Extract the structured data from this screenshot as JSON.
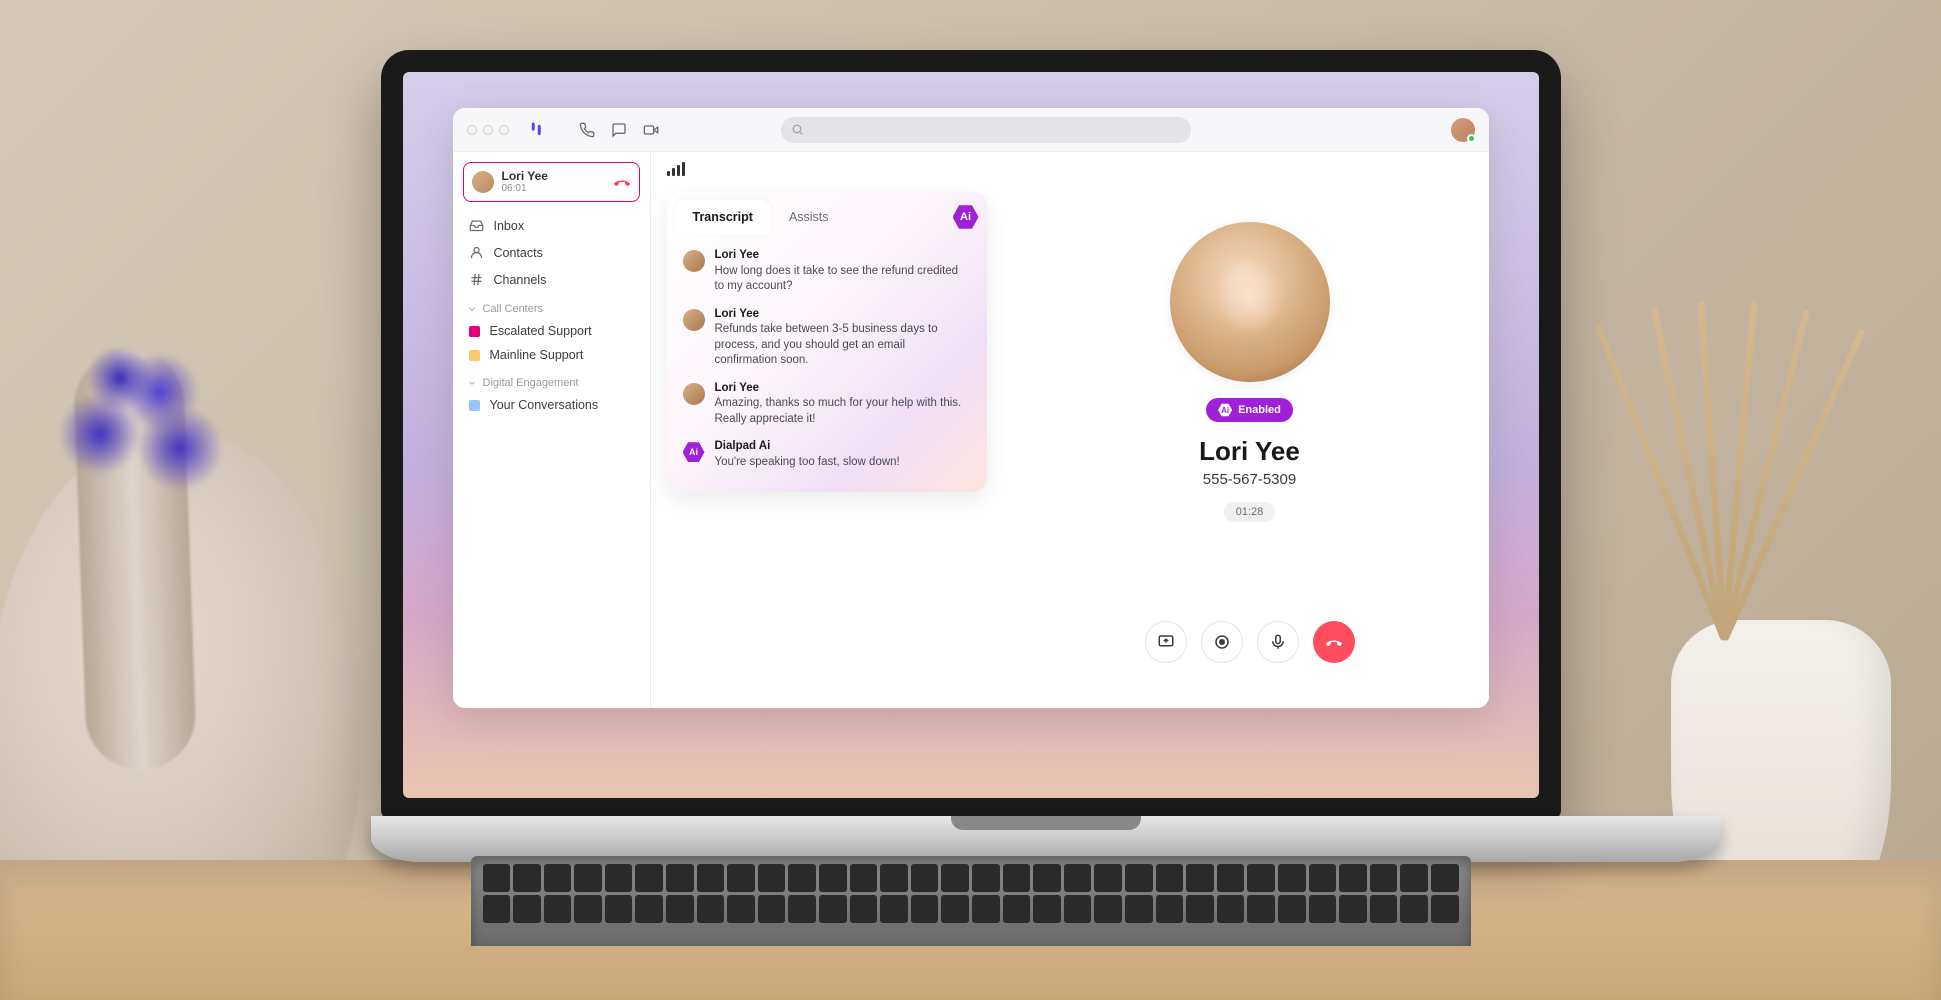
{
  "sidebar": {
    "active_call": {
      "name": "Lori Yee",
      "duration": "06:01"
    },
    "nav": {
      "inbox": "Inbox",
      "contacts": "Contacts",
      "channels": "Channels"
    },
    "sections": {
      "call_centers": {
        "label": "Call Centers",
        "items": [
          "Escalated Support",
          "Mainline Support"
        ]
      },
      "digital_engagement": {
        "label": "Digital Engagement",
        "items": [
          "Your Conversations"
        ]
      }
    }
  },
  "transcript": {
    "tabs": {
      "transcript": "Transcript",
      "assists": "Assists"
    },
    "ai_badge": "Ai",
    "messages": [
      {
        "speaker": "Lori Yee",
        "text": "How long does it take to see the refund credited to my account?"
      },
      {
        "speaker": "Lori Yee",
        "text": "Refunds take between 3-5 business days to process, and you should get an email confirmation soon."
      },
      {
        "speaker": "Lori Yee",
        "text": "Amazing, thanks so much for your help with this. Really appreciate it!"
      },
      {
        "speaker": "Dialpad Ai",
        "text": "You're speaking too fast, slow down!"
      }
    ]
  },
  "call": {
    "enabled_label": "Enabled",
    "name": "Lori Yee",
    "phone": "555-567-5309",
    "duration": "01:28"
  },
  "colors": {
    "brand_purple": "#a020d8",
    "accent_pink": "#e60073",
    "hangup_red": "#ff4d5e"
  }
}
